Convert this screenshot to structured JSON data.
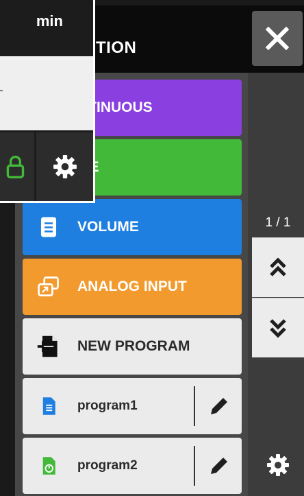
{
  "dialog": {
    "title": "TION",
    "close_icon": "close-icon"
  },
  "modes": [
    {
      "label": "NTINUOUS",
      "color": "#8a3fe0",
      "icon": "continuous-icon"
    },
    {
      "label": "ME",
      "color": "#43b93a",
      "icon": "time-icon"
    },
    {
      "label": "VOLUME",
      "color": "#1e7fe0",
      "icon": "volume-icon"
    },
    {
      "label": "ANALOG INPUT",
      "color": "#f39a2e",
      "icon": "analog-input-icon"
    },
    {
      "label": "NEW PROGRAM",
      "color": "#ebebeb",
      "icon": "new-program-icon"
    }
  ],
  "programs": [
    {
      "label": "program1",
      "icon": "program-file-icon",
      "icon_color": "#1e7fe0"
    },
    {
      "label": "program2",
      "icon": "program-timer-icon",
      "icon_color": "#43b93a"
    }
  ],
  "pager": {
    "indicator": "1 / 1"
  },
  "overlay": {
    "title": "min",
    "item_label": "T",
    "lock_color": "#43b93a"
  }
}
